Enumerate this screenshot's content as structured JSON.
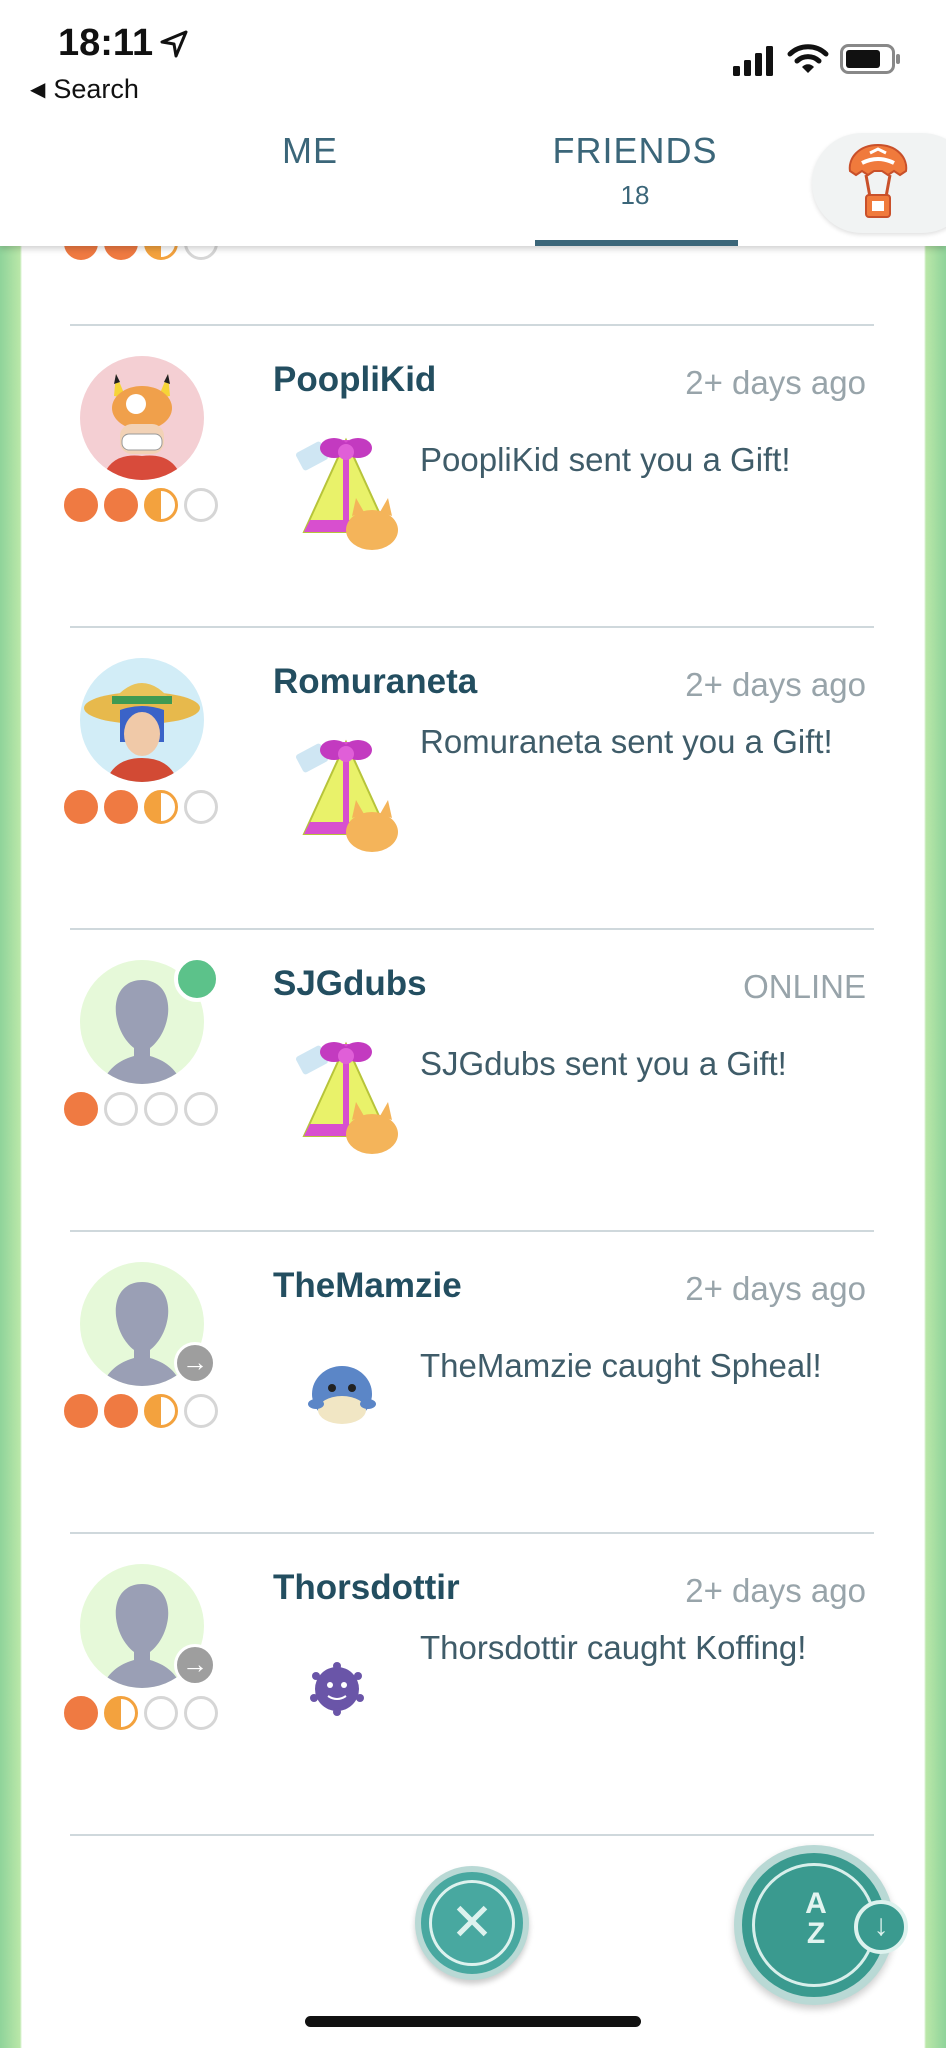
{
  "status_bar": {
    "time": "18:11",
    "back_label": "Search"
  },
  "tabs": [
    {
      "label": "ME",
      "count": ""
    },
    {
      "label": "FRIENDS",
      "count": "18"
    }
  ],
  "friends": [
    {
      "name": "PoopliKid",
      "when": "2+ days ago",
      "message": "PoopliKid sent you a Gift!",
      "hearts": [
        "full",
        "full",
        "half",
        "empty"
      ],
      "activity_icon": "gift-icon",
      "avatar": "pikachu-hat-trainer"
    },
    {
      "name": "Romuraneta",
      "when": "2+ days ago",
      "message": "Romuraneta sent you a Gift!",
      "hearts": [
        "full",
        "full",
        "half",
        "empty"
      ],
      "activity_icon": "gift-icon",
      "avatar": "sun-hat-trainer"
    },
    {
      "name": "SJGdubs",
      "when": "ONLINE",
      "message": "SJGdubs sent you a Gift!",
      "hearts": [
        "full",
        "empty",
        "empty",
        "empty"
      ],
      "activity_icon": "gift-icon",
      "avatar": "silhouette",
      "online": true
    },
    {
      "name": "TheMamzie",
      "when": "2+ days ago",
      "message": "TheMamzie caught Spheal!",
      "hearts": [
        "full",
        "full",
        "half",
        "empty"
      ],
      "activity_icon": "spheal-icon",
      "avatar": "silhouette"
    },
    {
      "name": "Thorsdottir",
      "when": "2+ days ago",
      "message": "Thorsdottir caught Koffing!",
      "hearts": [
        "full",
        "half",
        "empty",
        "empty"
      ],
      "activity_icon": "koffing-icon",
      "avatar": "silhouette"
    }
  ],
  "controls": {
    "close_symbol": "✕",
    "sort_label_top": "A",
    "sort_label_bottom": "Z",
    "sort_direction_symbol": "↓"
  },
  "colors": {
    "accent": "#3b6679",
    "heart_full": "#ef7a42",
    "heart_half": "#f3a23e",
    "online": "#5cc28a",
    "button_teal": "#3a9a8f"
  }
}
